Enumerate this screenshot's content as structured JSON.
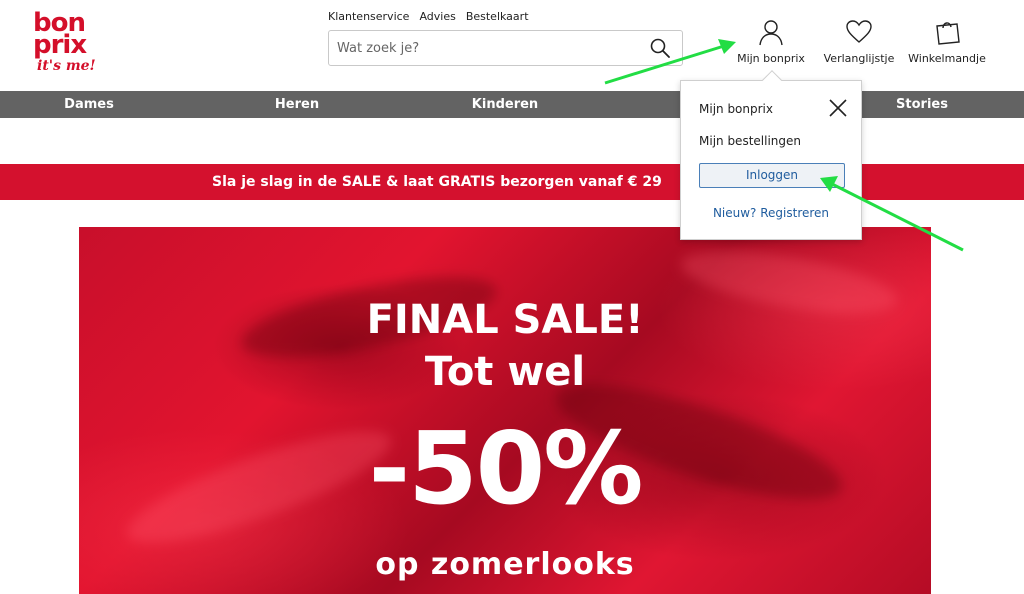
{
  "logo": {
    "line1": "bon",
    "line2": "prix",
    "tagline": "it's me!"
  },
  "toplinks": [
    "Klantenservice",
    "Advies",
    "Bestelkaart"
  ],
  "search": {
    "placeholder": "Wat zoek je?",
    "value": ""
  },
  "header_icons": {
    "account": {
      "label": "Mijn bonprix",
      "icon": "user-icon"
    },
    "wishlist": {
      "label": "Verlanglijstje",
      "icon": "heart-icon"
    },
    "cart": {
      "label": "Winkelmandje",
      "icon": "shopping-bag-icon"
    }
  },
  "nav": {
    "items": [
      "Dames",
      "Heren",
      "Kinderen",
      "Stories"
    ]
  },
  "promo": {
    "text": "Sla je slag in de SALE & laat GRATIS bezorgen vanaf € 29"
  },
  "hero": {
    "line1": "FINAL SALE!",
    "line2": "Tot wel",
    "line3": "-50%",
    "line4": "op zomerlooks"
  },
  "account_dropdown": {
    "title_link": "Mijn bonprix",
    "orders_link": "Mijn bestellingen",
    "login_button": "Inloggen",
    "register_link": "Nieuw? Registreren"
  },
  "colors": {
    "brand_red": "#d40f2a",
    "nav_gray": "#636363",
    "link_blue": "#1f5c9e",
    "annotation_green": "#22dd44"
  }
}
